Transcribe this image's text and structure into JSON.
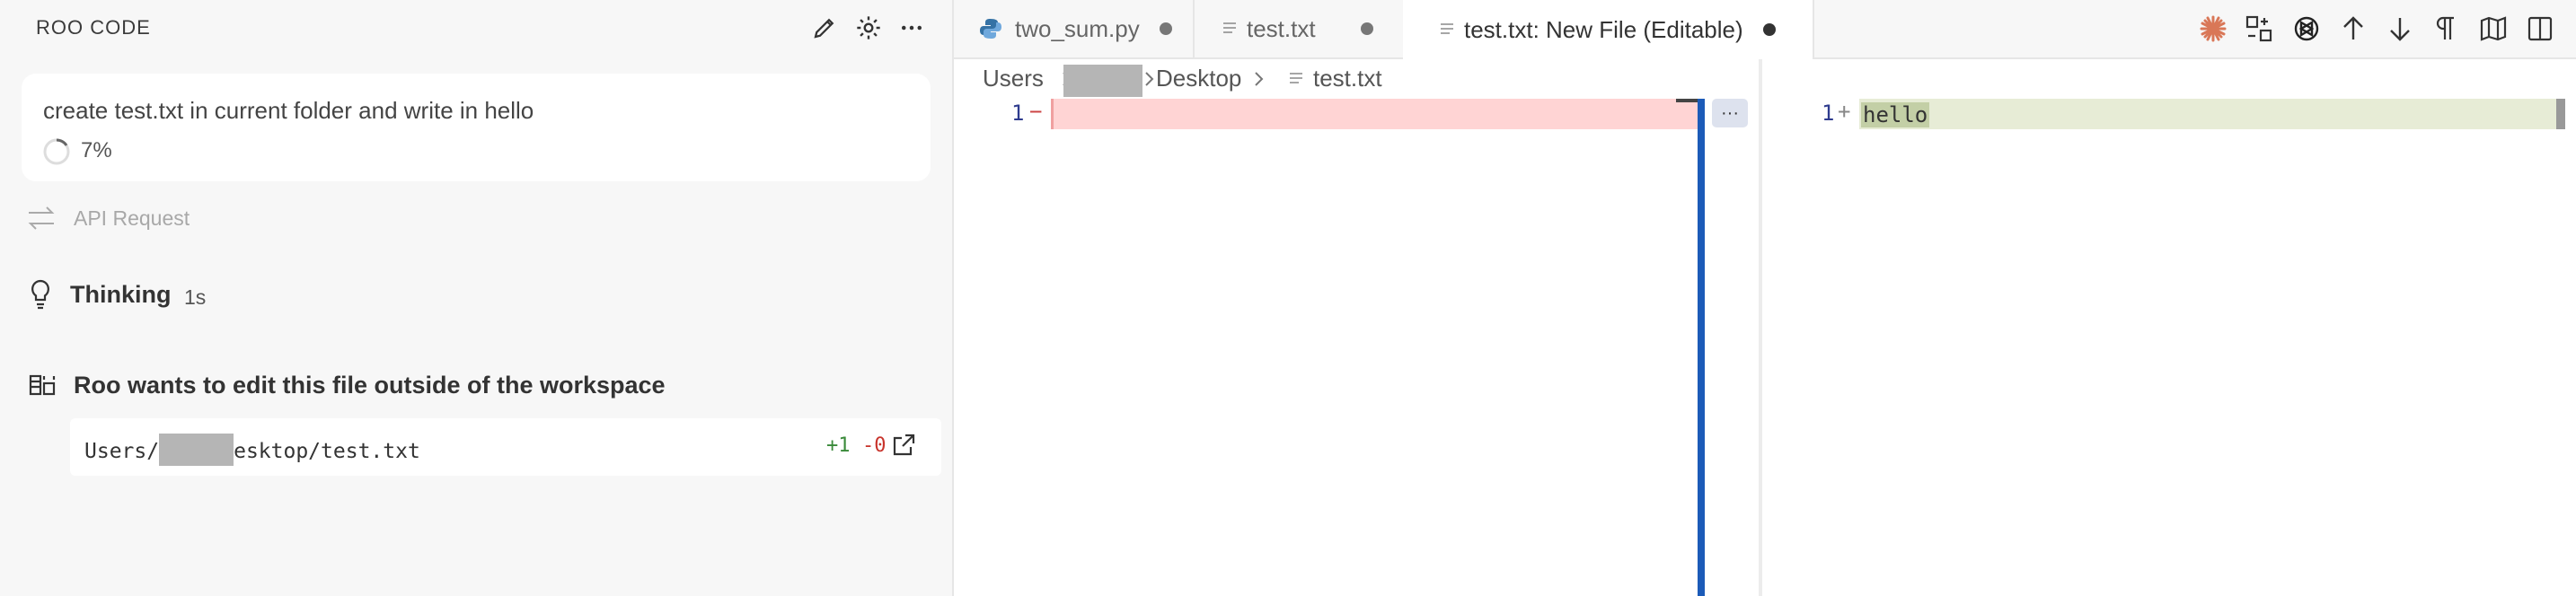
{
  "sidebar": {
    "title": "ROO CODE",
    "icons": [
      "pencil-icon",
      "gear-icon",
      "more-icon"
    ],
    "task": {
      "text": "create test.txt in current folder and write in hello",
      "progress": "7%"
    },
    "api_request": "API Request",
    "thinking": {
      "label": "Thinking",
      "time": "1s"
    },
    "edit_message": "Roo wants to edit this file outside of the workspace",
    "file": {
      "path_prefix": "Users/",
      "path_suffix": "esktop/test.txt",
      "added": "+1",
      "removed": "-0"
    }
  },
  "tabs": [
    {
      "label": "two_sum.py",
      "icon": "python-icon",
      "dirty": true
    },
    {
      "label": "test.txt",
      "icon": "file-lines-icon",
      "dirty": true
    },
    {
      "label": "test.txt: New File (Editable)",
      "icon": "file-lines-icon",
      "dirty": true,
      "active": true
    }
  ],
  "breadcrumb": {
    "root": "Users",
    "folder": "Desktop",
    "file": "test.txt"
  },
  "diff": {
    "left": {
      "line_number": "1",
      "marker": "−"
    },
    "right": {
      "line_number": "1",
      "marker": "+",
      "text": "hello"
    },
    "fold_label": "···"
  },
  "colors": {
    "removed_bg": "#ffd4d4",
    "added_bg": "#e7ecd6",
    "added_word_bg": "#c3cfa6",
    "scrollbar_accent": "#1c5bb8"
  }
}
